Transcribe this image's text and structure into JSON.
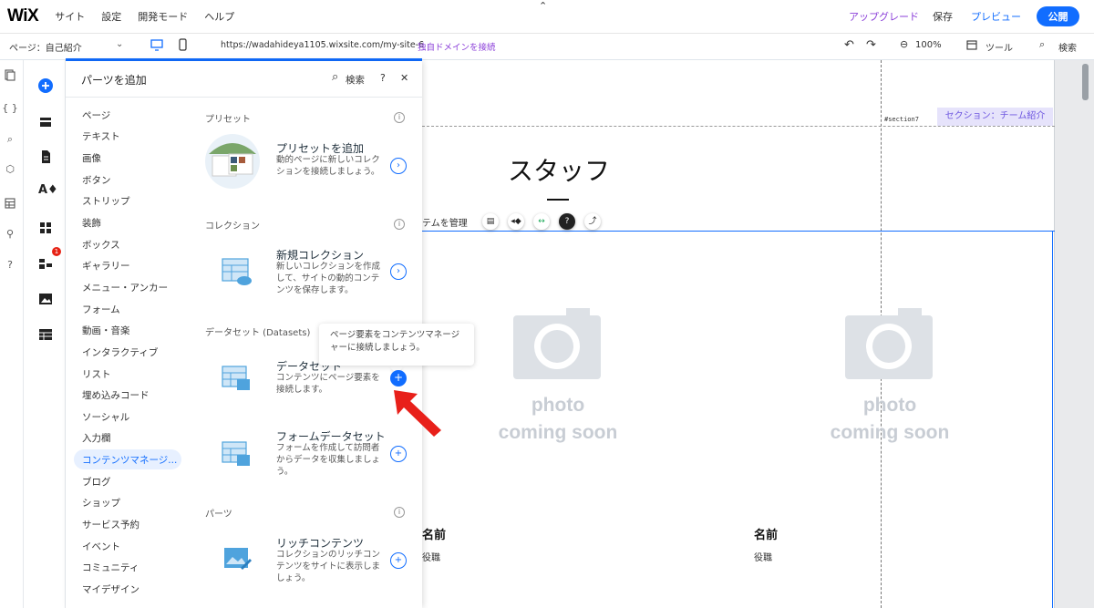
{
  "topbar": {
    "logo": "WiX",
    "menus": [
      "サイト",
      "設定",
      "開発モード",
      "ヘルプ"
    ],
    "upgrade": "アップグレード",
    "save": "保存",
    "preview": "プレビュー",
    "publish": "公開"
  },
  "bar2": {
    "page_select": "ページ：自己紹介",
    "url": "https://wadahideya1105.wixsite.com/my-site-6",
    "connect_domain": "独自ドメインを接続",
    "zoom": "100%",
    "tools": "ツール",
    "search": "検索"
  },
  "rail1": {
    "items": [
      "{ }"
    ]
  },
  "rail2": {
    "badge": "1"
  },
  "panel": {
    "title": "パーツを追加",
    "search": "検索",
    "help": "?",
    "close": "✕",
    "categories": [
      "ページ",
      "テキスト",
      "画像",
      "ボタン",
      "ストリップ",
      "装飾",
      "ボックス",
      "ギャラリー",
      "メニュー・アンカー",
      "フォーム",
      "動画・音楽",
      "インタラクティブ",
      "リスト",
      "埋め込みコード",
      "ソーシャル",
      "入力欄",
      "コンテンツマネージ...",
      "ブログ",
      "ショップ",
      "サービス予約",
      "イベント",
      "コミュニティ",
      "マイデザイン"
    ],
    "selected_category": "コンテンツマネージ...",
    "sections": {
      "preset": "プリセット",
      "collection": "コレクション",
      "dataset": "データセット (Datasets)",
      "parts": "パーツ"
    },
    "cards": [
      {
        "title": "プリセットを追加",
        "desc": "動的ページに新しいコレクションを接続しましょう。"
      },
      {
        "title": "新規コレクション",
        "desc": "新しいコレクションを作成して、サイトの動的コンテンツを保存します。"
      },
      {
        "title": "データセット",
        "desc": "コンテンツにページ要素を接続します。"
      },
      {
        "title": "フォームデータセット",
        "desc": "フォームを作成して訪問者からデータを収集しましょう。"
      },
      {
        "title": "リッチコンテンツ",
        "desc": "コレクションのリッチコンテンツをサイトに表示しましょう。"
      }
    ],
    "tooltip": "ページ要素をコンテンツマネージャーに接続しましょう。"
  },
  "canvas": {
    "section_anchor": "#section7",
    "section_tag": "セクション：チーム紹介",
    "title": "スタッフ",
    "title_dash": "ー",
    "toolbar_text": "テムを管理",
    "photo_line1": "photo",
    "photo_line2": "coming soon",
    "name_label": "名前",
    "role_label": "役職"
  },
  "colors": {
    "accent": "#116dff",
    "section_tag_bg": "#e6e3fb",
    "section_tag_text": "#6e57e0",
    "upgrade_text": "#8b3fd9",
    "annotation_arrow": "#e8201a"
  }
}
